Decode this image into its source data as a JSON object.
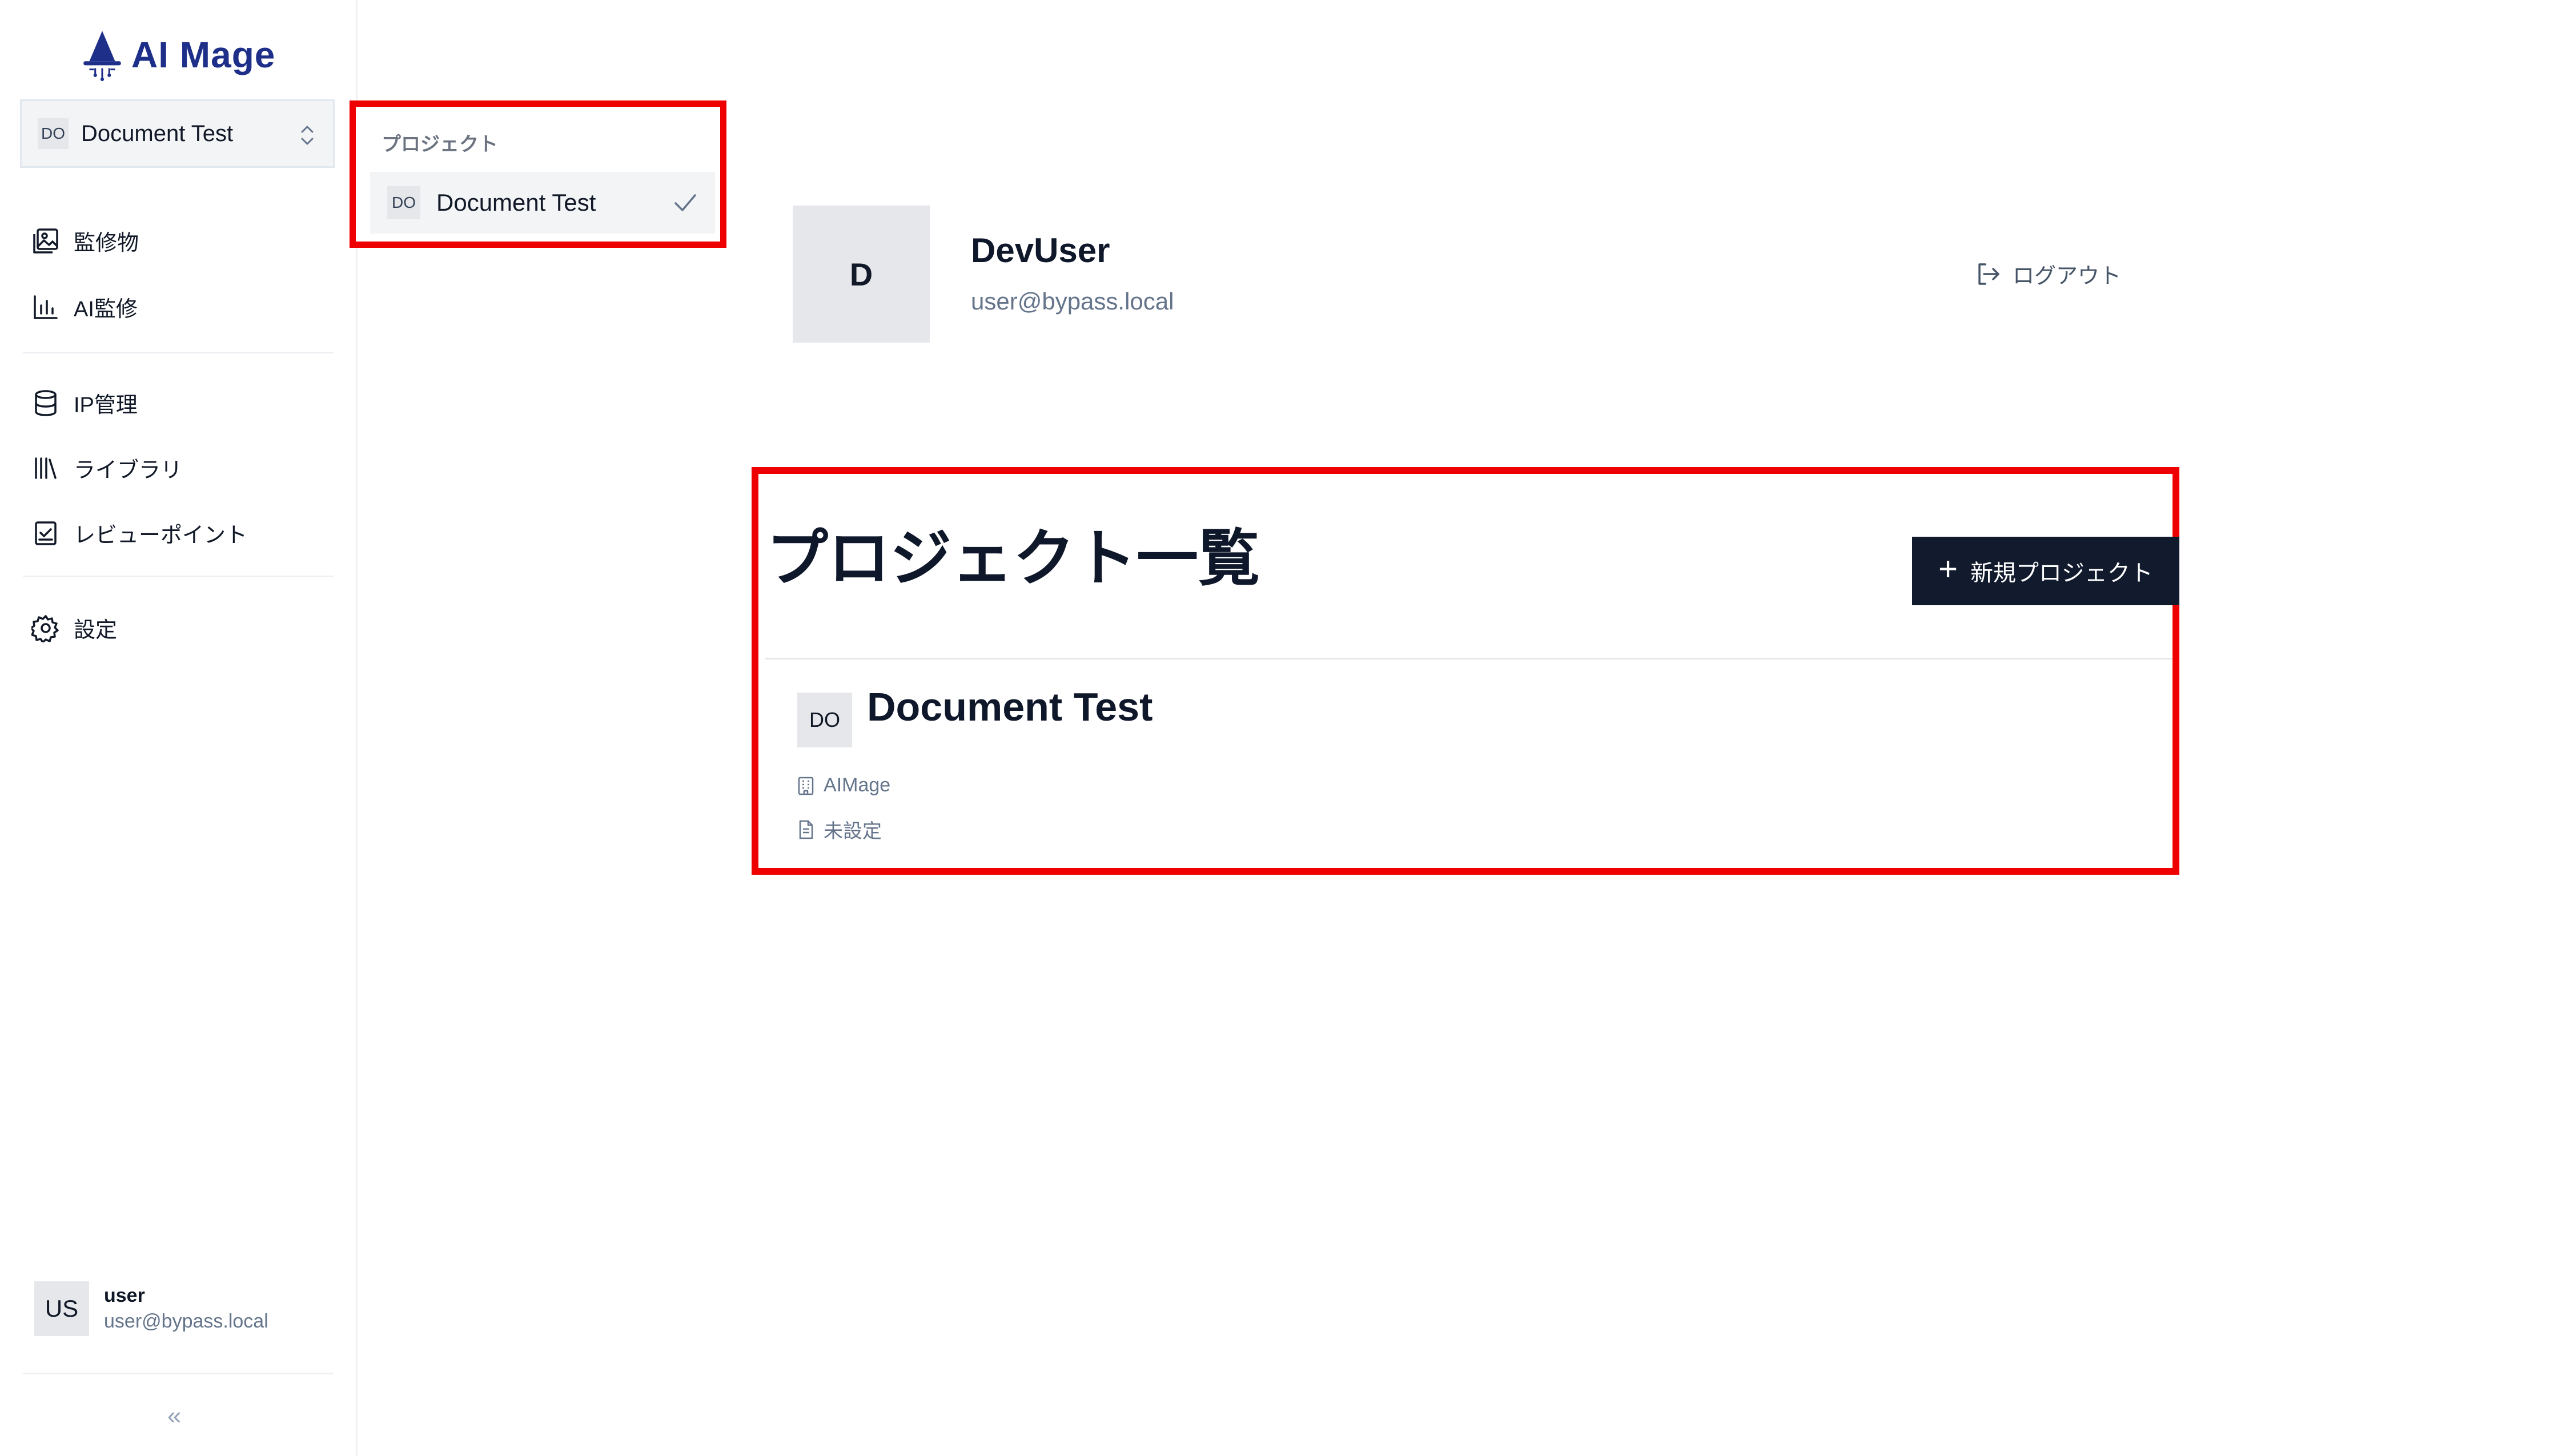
{
  "app": {
    "logo_text": "AI Mage"
  },
  "project_switcher": {
    "badge": "DO",
    "name": "Document Test"
  },
  "nav": {
    "items": [
      {
        "label": "監修物",
        "icon": "image-gallery-icon"
      },
      {
        "label": "AI監修",
        "icon": "bar-chart-icon"
      },
      {
        "label": "IP管理",
        "icon": "database-icon"
      },
      {
        "label": "ライブラリ",
        "icon": "library-icon"
      },
      {
        "label": "レビューポイント",
        "icon": "clipboard-check-icon"
      },
      {
        "label": "設定",
        "icon": "gear-icon"
      }
    ]
  },
  "sidebar_user": {
    "avatar": "US",
    "name": "user",
    "email": "user@bypass.local"
  },
  "collapse": {
    "label": "«"
  },
  "dropdown": {
    "label": "プロジェクト",
    "items": [
      {
        "badge": "DO",
        "name": "Document Test",
        "selected": true
      }
    ]
  },
  "profile": {
    "avatar": "D",
    "name": "DevUser",
    "email": "user@bypass.local"
  },
  "logout": {
    "label": "ログアウト"
  },
  "projects": {
    "title": "プロジェクト一覧",
    "new_button": {
      "icon": "+",
      "label": "新規プロジェクト"
    },
    "cards": [
      {
        "badge": "DO",
        "title": "Document Test",
        "organization": "AIMage",
        "document": "未設定"
      }
    ]
  },
  "colors": {
    "highlight": "#ee0000",
    "primary_button": "#121b2e",
    "brand": "#1e2f8a"
  }
}
